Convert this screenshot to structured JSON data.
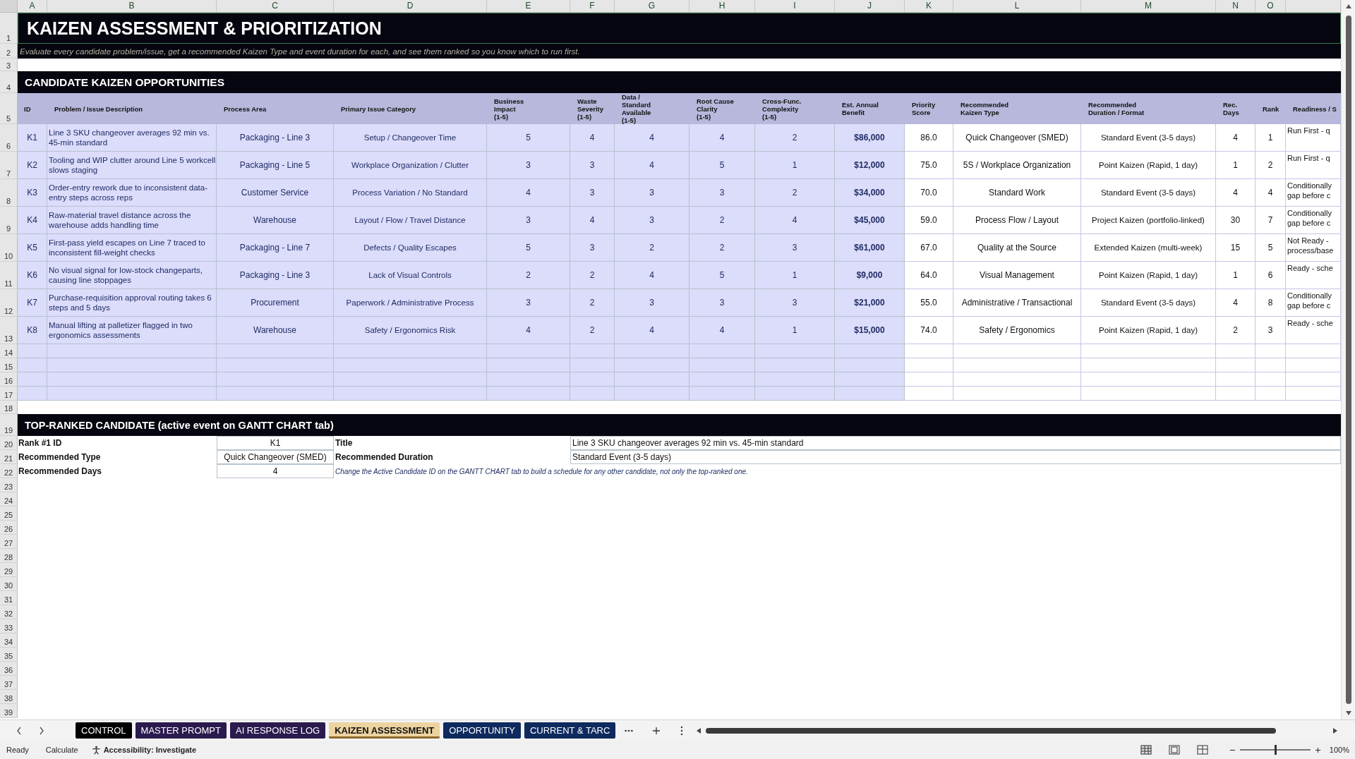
{
  "columns": [
    "A",
    "B",
    "C",
    "D",
    "E",
    "F",
    "G",
    "H",
    "I",
    "J",
    "K",
    "L",
    "M",
    "N",
    "O"
  ],
  "row_numbers": [
    "1",
    "2",
    "3",
    "4",
    "5",
    "6",
    "7",
    "8",
    "9",
    "10",
    "11",
    "12",
    "13",
    "14",
    "15",
    "16",
    "17",
    "18",
    "19",
    "20",
    "21",
    "22",
    "23",
    "24",
    "25",
    "26",
    "27",
    "28",
    "29",
    "30",
    "31",
    "32",
    "33",
    "34",
    "35",
    "36",
    "37",
    "38",
    "39"
  ],
  "title": "KAIZEN ASSESSMENT & PRIORITIZATION",
  "subtitle": "Evaluate every candidate problem/issue, get a recommended Kaizen Type and event duration for each, and see them ranked so you know which to run first.",
  "candidates": {
    "heading": "CANDIDATE KAIZEN OPPORTUNITIES",
    "headers": [
      [
        "ID"
      ],
      [
        "Problem / Issue Description"
      ],
      [
        "Process Area"
      ],
      [
        "Primary Issue Category"
      ],
      [
        "Business",
        "Impact",
        "(1-5)"
      ],
      [
        "Waste",
        "Severity",
        "(1-5)"
      ],
      [
        "Data /",
        "Standard",
        "Available",
        "(1-5)"
      ],
      [
        "Root Cause",
        "Clarity",
        "(1-5)"
      ],
      [
        "Cross-Func.",
        "Complexity",
        "(1-5)"
      ],
      [
        "Est. Annual",
        "Benefit"
      ],
      [
        "Priority",
        "Score"
      ],
      [
        "Recommended",
        "Kaizen Type"
      ],
      [
        "Recommended",
        "Duration / Format"
      ],
      [
        "Rec.",
        "Days"
      ],
      [
        "Rank"
      ],
      [
        "Readiness / S"
      ]
    ],
    "rows": [
      {
        "id": "K1",
        "description": "Line 3 SKU changeover averages 92 min vs. 45-min standard",
        "process_area": "Packaging - Line 3",
        "category": "Setup / Changeover Time",
        "impact": "5",
        "waste": "4",
        "data": "4",
        "clarity": "4",
        "complexity": "2",
        "benefit": "$86,000",
        "score": "86.0",
        "kaizen_type": "Quick Changeover (SMED)",
        "duration": "Standard Event (3-5 days)",
        "days": "4",
        "rank": "1",
        "readiness": [
          "Run First - q"
        ]
      },
      {
        "id": "K2",
        "description": "Tooling and WIP clutter around Line 5 workcell slows staging",
        "process_area": "Packaging - Line 5",
        "category": "Workplace Organization / Clutter",
        "impact": "3",
        "waste": "3",
        "data": "4",
        "clarity": "5",
        "complexity": "1",
        "benefit": "$12,000",
        "score": "75.0",
        "kaizen_type": "5S / Workplace Organization",
        "duration": "Point Kaizen (Rapid, 1 day)",
        "days": "1",
        "rank": "2",
        "readiness": [
          "Run First - q"
        ]
      },
      {
        "id": "K3",
        "description": "Order-entry rework due to inconsistent data-entry steps across reps",
        "process_area": "Customer Service",
        "category": "Process Variation / No Standard",
        "impact": "4",
        "waste": "3",
        "data": "3",
        "clarity": "3",
        "complexity": "2",
        "benefit": "$34,000",
        "score": "70.0",
        "kaizen_type": "Standard Work",
        "duration": "Standard Event (3-5 days)",
        "days": "4",
        "rank": "4",
        "readiness": [
          "Conditionally",
          "gap before c"
        ]
      },
      {
        "id": "K4",
        "description": "Raw-material travel distance across the warehouse adds handling time",
        "process_area": "Warehouse",
        "category": "Layout / Flow / Travel Distance",
        "impact": "3",
        "waste": "4",
        "data": "3",
        "clarity": "2",
        "complexity": "4",
        "benefit": "$45,000",
        "score": "59.0",
        "kaizen_type": "Process Flow / Layout",
        "duration": "Project Kaizen (portfolio-linked)",
        "days": "30",
        "rank": "7",
        "readiness": [
          "Conditionally",
          "gap before c"
        ]
      },
      {
        "id": "K5",
        "description": "First-pass yield escapes on Line 7 traced to inconsistent fill-weight checks",
        "process_area": "Packaging - Line 7",
        "category": "Defects / Quality Escapes",
        "impact": "5",
        "waste": "3",
        "data": "2",
        "clarity": "2",
        "complexity": "3",
        "benefit": "$61,000",
        "score": "67.0",
        "kaizen_type": "Quality at the Source",
        "duration": "Extended Kaizen (multi-week)",
        "days": "15",
        "rank": "5",
        "readiness": [
          "Not Ready -",
          "process/base"
        ]
      },
      {
        "id": "K6",
        "description": "No visual signal for low-stock changeparts, causing line stoppages",
        "process_area": "Packaging - Line 3",
        "category": "Lack of Visual Controls",
        "impact": "2",
        "waste": "2",
        "data": "4",
        "clarity": "5",
        "complexity": "1",
        "benefit": "$9,000",
        "score": "64.0",
        "kaizen_type": "Visual Management",
        "duration": "Point Kaizen (Rapid, 1 day)",
        "days": "1",
        "rank": "6",
        "readiness": [
          "Ready - sche"
        ]
      },
      {
        "id": "K7",
        "description": "Purchase-requisition approval routing takes 6 steps and 5 days",
        "process_area": "Procurement",
        "category": "Paperwork / Administrative Process",
        "impact": "3",
        "waste": "2",
        "data": "3",
        "clarity": "3",
        "complexity": "3",
        "benefit": "$21,000",
        "score": "55.0",
        "kaizen_type": "Administrative / Transactional",
        "duration": "Standard Event (3-5 days)",
        "days": "4",
        "rank": "8",
        "readiness": [
          "Conditionally",
          "gap before c"
        ]
      },
      {
        "id": "K8",
        "description": "Manual lifting at palletizer flagged in two ergonomics assessments",
        "process_area": "Warehouse",
        "category": "Safety / Ergonomics Risk",
        "impact": "4",
        "waste": "2",
        "data": "4",
        "clarity": "4",
        "complexity": "1",
        "benefit": "$15,000",
        "score": "74.0",
        "kaizen_type": "Safety / Ergonomics",
        "duration": "Point Kaizen (Rapid, 1 day)",
        "days": "2",
        "rank": "3",
        "readiness": [
          "Ready - sche"
        ]
      }
    ]
  },
  "top_ranked": {
    "heading": "TOP-RANKED CANDIDATE  (active event on GANTT CHART tab)",
    "rank_label": "Rank #1 ID",
    "rank_value": "K1",
    "title_label": "Title",
    "title_value": "Line 3 SKU changeover averages 92 min vs. 45-min standard",
    "type_label": "Recommended Type",
    "type_value": "Quick Changeover (SMED)",
    "duration_label": "Recommended Duration",
    "duration_value": "Standard Event (3-5 days)",
    "days_label": "Recommended Days",
    "days_value": "4",
    "note": "Change the Active Candidate ID on the GANTT CHART tab to build a schedule for any other candidate, not only the top-ranked one."
  },
  "tabs": [
    {
      "label": "CONTROL",
      "color": "#000000",
      "selected": false
    },
    {
      "label": "MASTER PROMPT",
      "color": "#2b1a4e",
      "selected": false
    },
    {
      "label": "AI RESPONSE LOG",
      "color": "#2b1a4e",
      "selected": false
    },
    {
      "label": "KAIZEN ASSESSMENT",
      "color": "#ecd3a0",
      "selected": true
    },
    {
      "label": "OPPORTUNITY",
      "color": "#0e2a5e",
      "selected": false
    },
    {
      "label": "CURRENT & TARC",
      "color": "#0e2a5e",
      "selected": false
    }
  ],
  "status_bar": {
    "mode": "Ready",
    "calculate": "Calculate",
    "accessibility": "Accessibility: Investigate",
    "zoom": "100%",
    "zoom_slider": {
      "level": 0.5
    }
  }
}
